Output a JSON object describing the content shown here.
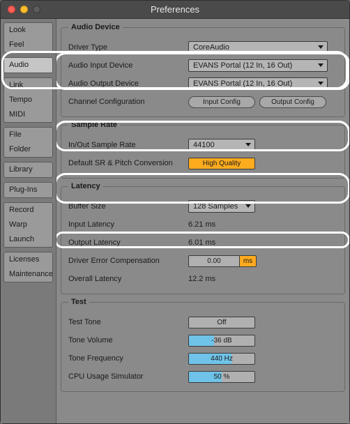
{
  "window": {
    "title": "Preferences"
  },
  "sidebar": {
    "groups": [
      [
        "Look",
        "Feel"
      ],
      [
        "Audio"
      ],
      [
        "Link",
        "Tempo",
        "MIDI"
      ],
      [
        "File",
        "Folder"
      ],
      [
        "Library"
      ],
      [
        "Plug-Ins"
      ],
      [
        "Record",
        "Warp",
        "Launch"
      ],
      [
        "Licenses",
        "Maintenance"
      ]
    ],
    "active": "Audio"
  },
  "sections": {
    "audio_device": {
      "legend": "Audio Device",
      "driver_type_label": "Driver Type",
      "driver_type_value": "CoreAudio",
      "input_device_label": "Audio Input Device",
      "input_device_value": "EVANS Portal (12 In, 16 Out)",
      "output_device_label": "Audio Output Device",
      "output_device_value": "EVANS Portal (12 In, 16 Out)",
      "channel_config_label": "Channel Configuration",
      "input_config_btn": "Input Config",
      "output_config_btn": "Output Config"
    },
    "sample_rate": {
      "legend": "Sample Rate",
      "rate_label": "In/Out Sample Rate",
      "rate_value": "44100",
      "sr_conv_label": "Default SR & Pitch Conversion",
      "sr_conv_value": "High Quality"
    },
    "latency": {
      "legend": "Latency",
      "buffer_label": "Buffer Size",
      "buffer_value": "128 Samples",
      "input_lat_label": "Input Latency",
      "input_lat_value": "6.21 ms",
      "output_lat_label": "Output Latency",
      "output_lat_value": "6.01 ms",
      "driver_comp_label": "Driver Error Compensation",
      "driver_comp_value": "0.00",
      "driver_comp_unit": "ms",
      "overall_lat_label": "Overall Latency",
      "overall_lat_value": "12.2 ms"
    },
    "test": {
      "legend": "Test",
      "test_tone_label": "Test Tone",
      "test_tone_value": "Off",
      "tone_volume_label": "Tone Volume",
      "tone_volume_value": "-36 dB",
      "tone_volume_fill": 38,
      "tone_freq_label": "Tone Frequency",
      "tone_freq_value": "440 Hz",
      "tone_freq_fill": 65,
      "cpu_label": "CPU Usage Simulator",
      "cpu_value": "50 %",
      "cpu_fill": 50
    }
  }
}
